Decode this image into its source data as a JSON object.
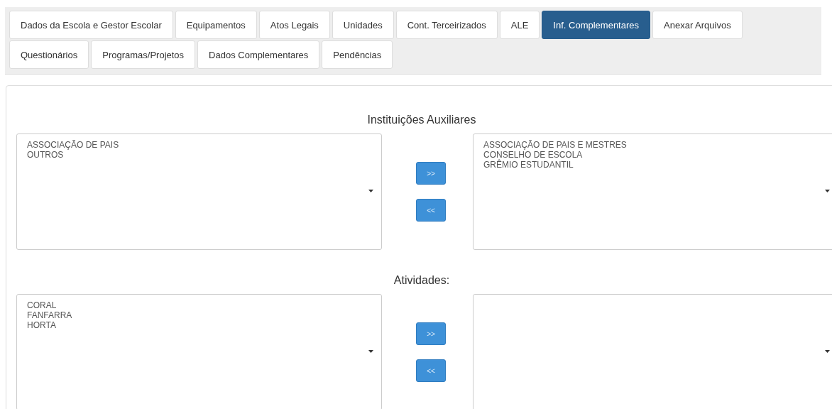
{
  "tabs": [
    {
      "label": "Dados da Escola e Gestor Escolar",
      "selected": false
    },
    {
      "label": "Equipamentos",
      "selected": false
    },
    {
      "label": "Atos Legais",
      "selected": false
    },
    {
      "label": "Unidades",
      "selected": false
    },
    {
      "label": "Cont. Terceirizados",
      "selected": false
    },
    {
      "label": "ALE",
      "selected": false
    },
    {
      "label": "Inf. Complementares",
      "selected": true
    },
    {
      "label": "Anexar Arquivos",
      "selected": false
    },
    {
      "label": "Questionários",
      "selected": false
    },
    {
      "label": "Programas/Projetos",
      "selected": false
    },
    {
      "label": "Dados Complementares",
      "selected": false
    },
    {
      "label": "Pendências",
      "selected": false
    }
  ],
  "sections": [
    {
      "title": "Instituições Auxiliares",
      "available": [
        "ASSOCIAÇÃO DE PAIS",
        "OUTROS"
      ],
      "add_button": ">>",
      "remove_button": "<<",
      "chosen": [
        "ASSOCIAÇÃO DE PAIS E MESTRES",
        "CONSELHO DE ESCOLA",
        "GRÊMIO ESTUDANTIL"
      ]
    },
    {
      "title": "Atividades:",
      "available": [
        "CORAL",
        "FANFARRA",
        "HORTA"
      ],
      "add_button": ">>",
      "remove_button": "<<"
    }
  ]
}
